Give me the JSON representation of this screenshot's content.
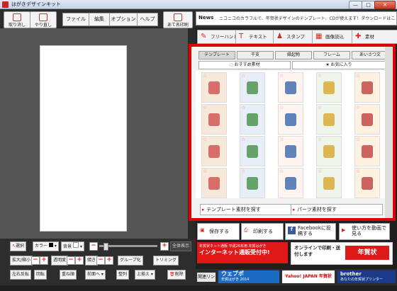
{
  "window": {
    "title": "はがきデザインキット",
    "min": "—",
    "max": "□",
    "close": "✕"
  },
  "toolbar": {
    "undo": "取り消し",
    "redo": "やり直し",
    "file": "ファイル",
    "edit": "編集",
    "options": "オプション",
    "help": "ヘルプ",
    "address_print": "あて名印刷"
  },
  "news": {
    "label": "News",
    "text": "ニコニコのカラフルで、年賀状デザインのテンプレート、CDが使えます！ダウンロードはこちら"
  },
  "material_tabs": [
    {
      "label": "フリーハンド",
      "icon": "pencil-icon"
    },
    {
      "label": "テキスト",
      "icon": "text-icon"
    },
    {
      "label": "スタンプ",
      "icon": "stamp-icon"
    },
    {
      "label": "画像読込",
      "icon": "image-icon"
    },
    {
      "label": "素材",
      "icon": "material-icon"
    }
  ],
  "categories": [
    {
      "label": "テンプレート",
      "selected": true
    },
    {
      "label": "干支"
    },
    {
      "label": "縁起物"
    },
    {
      "label": "フレーム"
    },
    {
      "label": "あいさつ文"
    }
  ],
  "subtabs": {
    "recommended": "おすすめ素材",
    "favorites": "お気に入り"
  },
  "search": {
    "template": "テンプレート素材を探す",
    "parts": "パーツ素材を探す"
  },
  "actions": {
    "save": "保存する",
    "print": "印刷する",
    "facebook": "Facebookに投稿する",
    "howto": "使い方を動画で見る"
  },
  "banners": {
    "net_delivery_small": "年賀状ネット通販 平成26年用 年賀はがき",
    "net_delivery": "インターネット通販受付中!",
    "online_print": "オンラインで印刷・送付します",
    "postcard_nengajo": "年賀状",
    "link": "関連リンク",
    "webpost": "ウェブポ",
    "webpost_sub": "年賀はがき 2014",
    "yahoo": "Yahoo! JAPAN 年賀状",
    "brother": "brother",
    "brother_sub": "あなたの年賀状プリンター"
  },
  "tools": {
    "select": "選択",
    "color": "カラー",
    "background": "背景",
    "zoom_all": "全体表示",
    "size": "拡大/縮小",
    "opacity": "透明度",
    "tilt": "傾き",
    "group": "グループ化",
    "trim": "トリミング",
    "flip_h": "左右反転",
    "flip_v": "上下反転",
    "rotate": "回転",
    "layer": "重ね順",
    "move_up": "前面へ",
    "align": "整列",
    "align_top": "上揃え",
    "delete": "削除"
  },
  "colors": {
    "accent": "#e00000"
  }
}
